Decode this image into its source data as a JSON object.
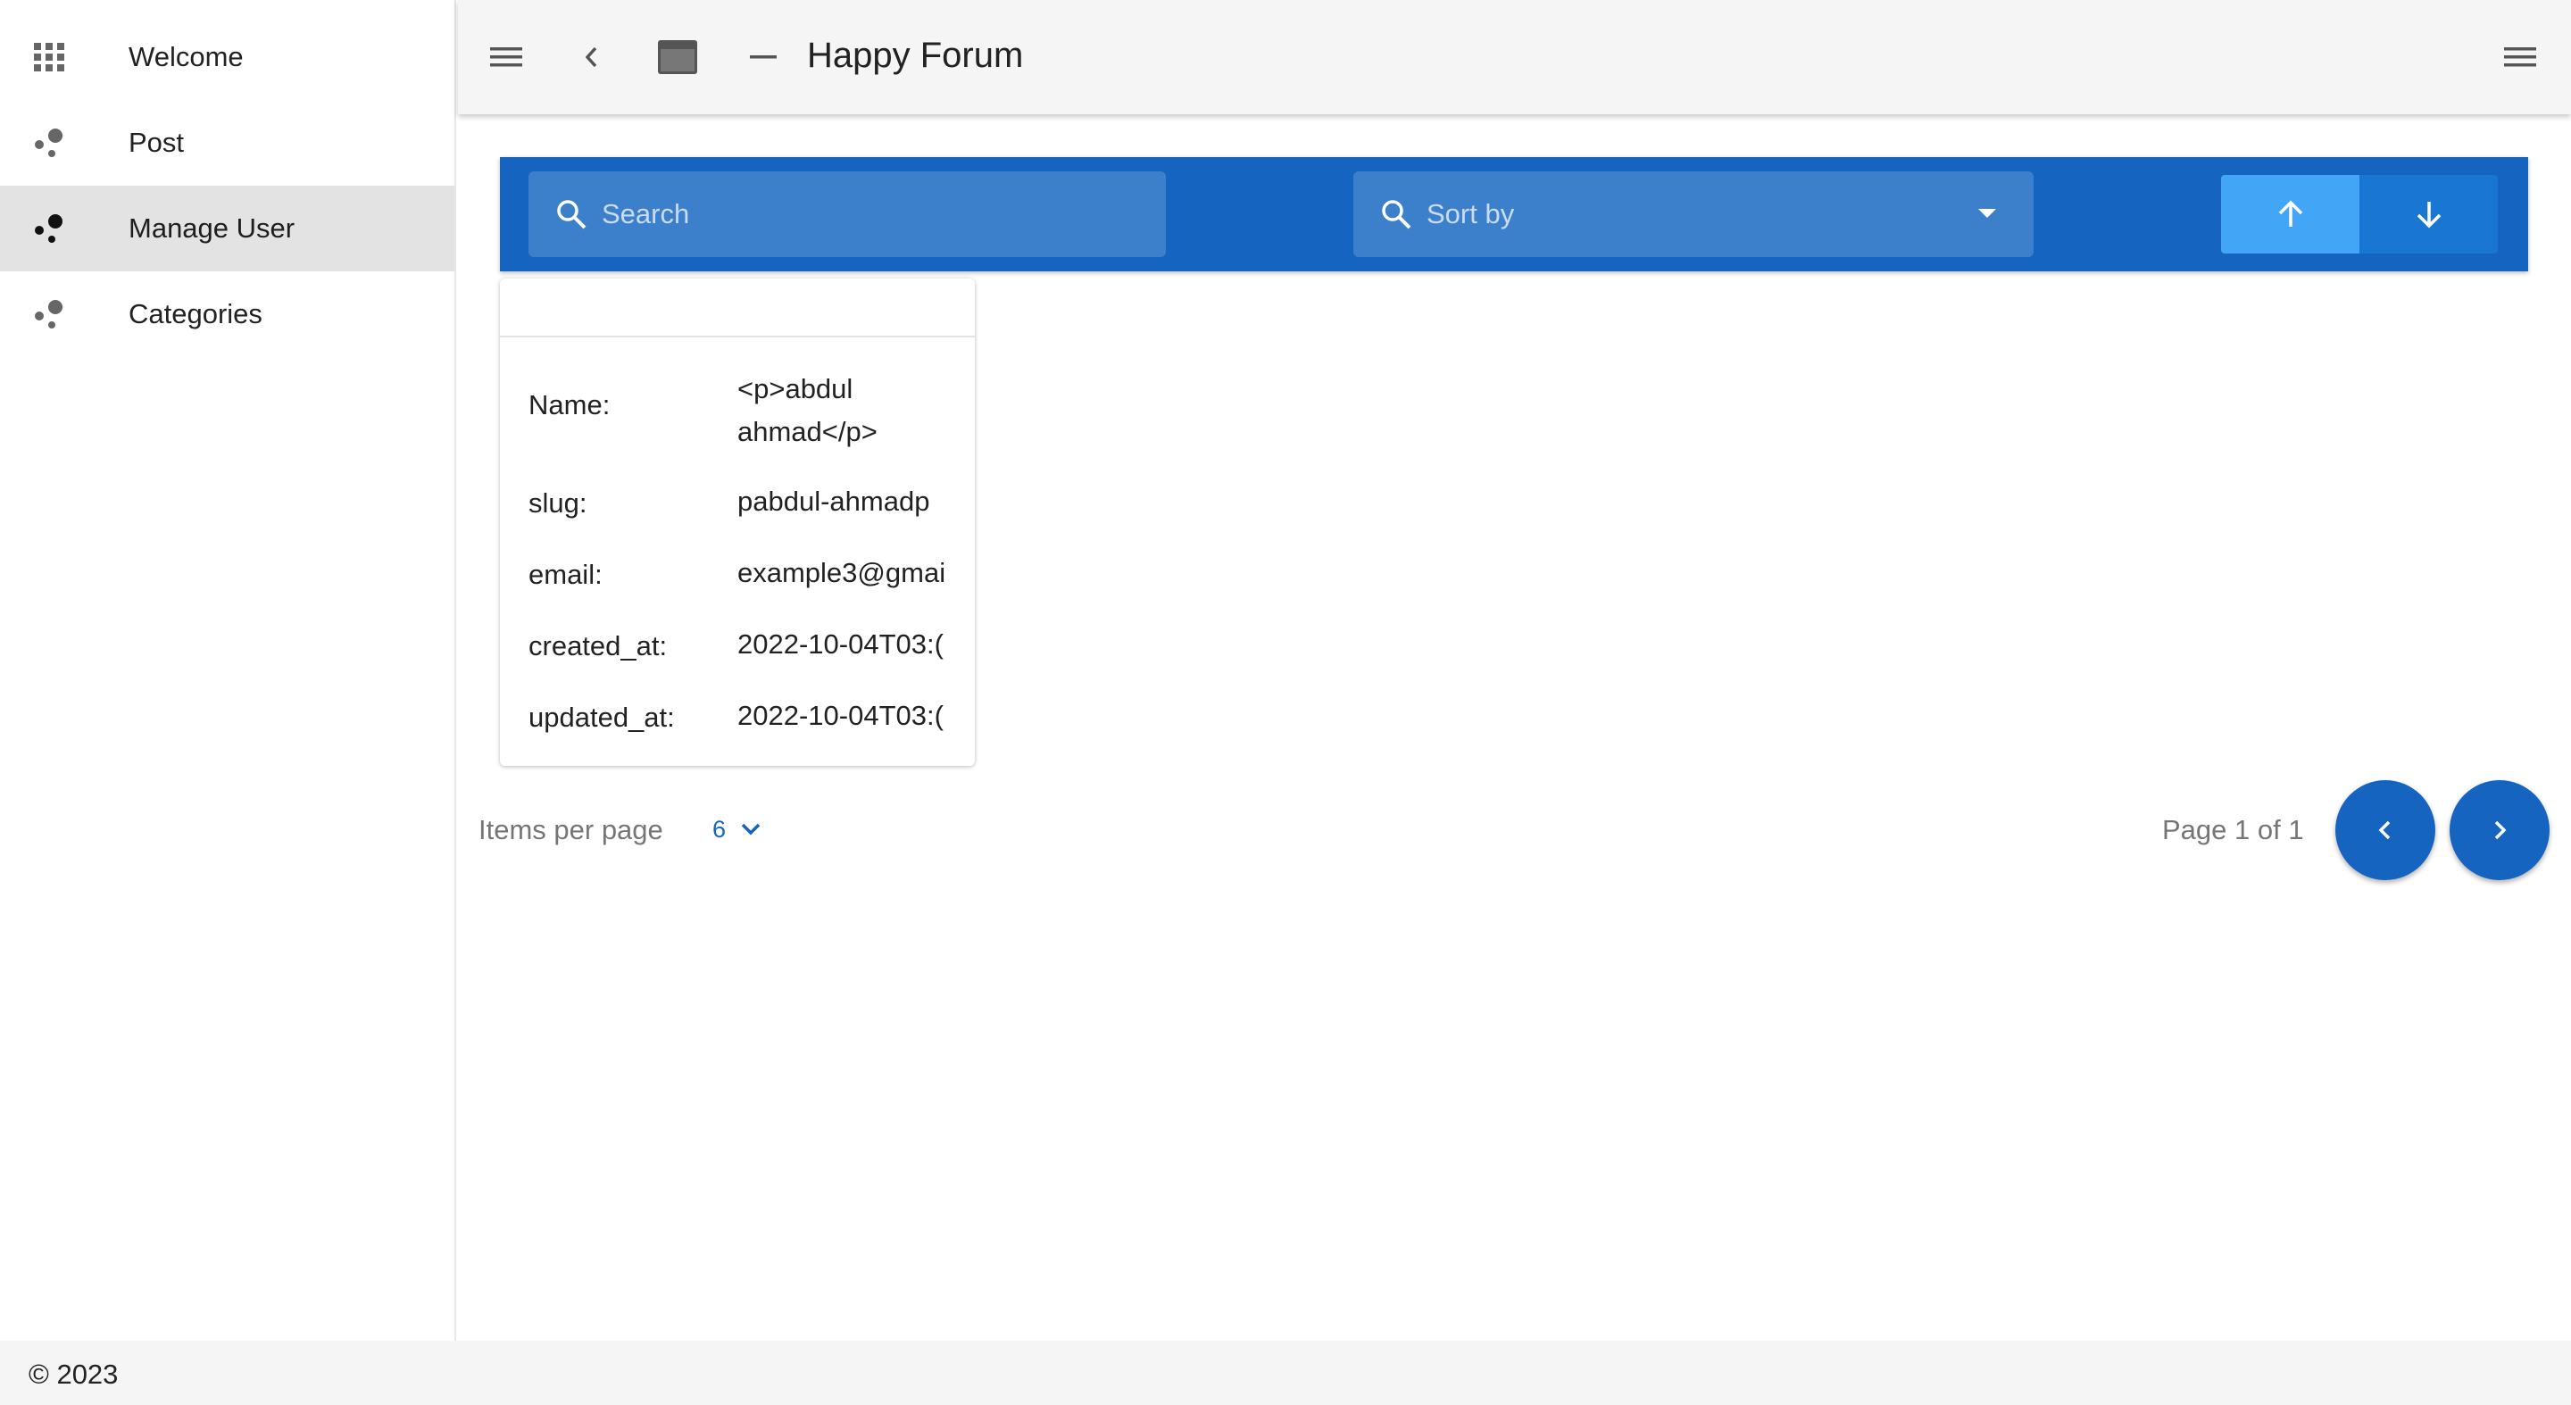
{
  "sidebar": {
    "items": [
      {
        "label": "Welcome",
        "icon": "apps-grid-icon"
      },
      {
        "label": "Post",
        "icon": "bubble-chart-icon"
      },
      {
        "label": "Manage User",
        "icon": "bubble-chart-icon",
        "active": true
      },
      {
        "label": "Categories",
        "icon": "bubble-chart-icon"
      }
    ]
  },
  "header": {
    "title": "Happy Forum",
    "icons": [
      "menu-icon",
      "chevron-left-icon",
      "window-icon",
      "minimize-icon",
      "menu-icon"
    ]
  },
  "toolbar": {
    "search_placeholder": "Search",
    "sort_placeholder": "Sort by",
    "sort_icons": [
      "arrow-up-icon",
      "arrow-down-icon"
    ]
  },
  "card": {
    "fields": [
      {
        "key": "Name:",
        "value": "<p>abdul ahmad</p>"
      },
      {
        "key": "slug:",
        "value": "pabdul-ahmadp"
      },
      {
        "key": "email:",
        "value": "example3@gmai"
      },
      {
        "key": "created_at:",
        "value": "2022-10-04T03:("
      },
      {
        "key": "updated_at:",
        "value": "2022-10-04T03:("
      }
    ]
  },
  "pagination": {
    "items_per_page_label": "Items per page",
    "items_per_page_value": "6",
    "page_text": "Page 1 of 1"
  },
  "footer": {
    "text": "© 2023"
  },
  "colors": {
    "primary": "#1565c0",
    "active_sort": "#42a5f5",
    "sidebar_active": "#e3e3e3",
    "header_bg": "#f5f5f5"
  }
}
